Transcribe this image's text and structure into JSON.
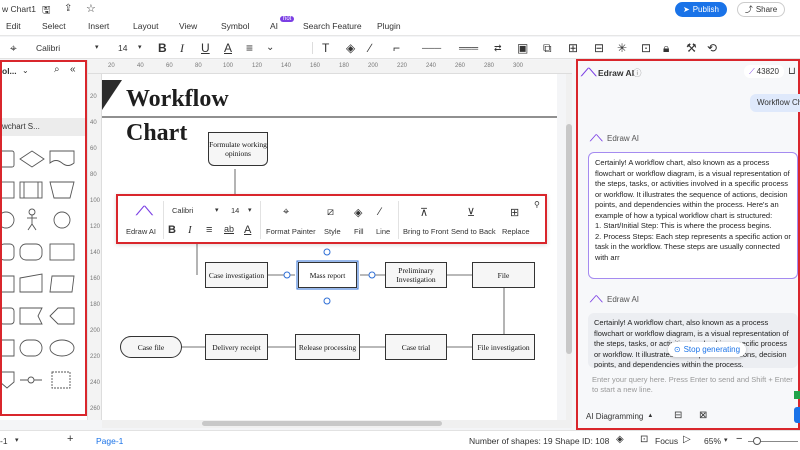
{
  "titlebar": {
    "doc_name": "w Chart1",
    "publish": "Publish",
    "share": "Share",
    "ai_badge": "hot"
  },
  "menu": {
    "edit": "Edit",
    "select": "Select",
    "insert": "Insert",
    "layout": "Layout",
    "view": "View",
    "symbol": "Symbol",
    "ai": "AI",
    "search_feature": "Search Feature",
    "plugin": "Plugin"
  },
  "toolbar": {
    "font": "Calibri",
    "size": "14"
  },
  "left_panel": {
    "title": "ol...",
    "item": "wchart S..."
  },
  "canvas": {
    "title_line1": "Workflow",
    "title_line2": "Chart",
    "nodes": {
      "formulate": "Formulate working opinions",
      "case_investigation": "Case investigation",
      "mass_report": "Mass report",
      "preliminary": "Preliminary Investigation",
      "file": "File",
      "file_investigation": "File investigation",
      "case_trial": "Case trial",
      "release": "Release processing",
      "delivery": "Delivery receipt",
      "case_file": "Case file"
    },
    "ruler_top": [
      "20",
      "40",
      "60",
      "80",
      "100",
      "120",
      "140",
      "160",
      "180",
      "200",
      "220",
      "240",
      "260",
      "280",
      "300"
    ],
    "ruler_left": [
      "20",
      "40",
      "60",
      "80",
      "100",
      "120",
      "140",
      "160",
      "180",
      "200",
      "220",
      "240",
      "260"
    ]
  },
  "floating_bar": {
    "edraw_ai": "Edraw AI",
    "font": "Calibri",
    "size": "14",
    "format_painter": "Format Painter",
    "style": "Style",
    "fill": "Fill",
    "line": "Line",
    "bring_to_front": "Bring to Front",
    "send_to_back": "Send to Back",
    "replace": "Replace"
  },
  "ai_panel": {
    "title": "Edraw AI",
    "credits": "43820",
    "user_message": "Workflow Ch",
    "assistant_label": "Edraw AI",
    "response1": "Certainly! A workflow chart, also known as a process flowchart or workflow diagram, is a visual representation of the steps, tasks, or activities involved in a specific process or workflow. It illustrates the sequence of actions, decision points, and dependencies within the process. Here's an example of how a typical workflow chart is structured:\n1. Start/Initial Step: This is where the process begins.\n2. Process Steps: Each step represents a specific action or task in the workflow. These steps are usually connected with arr",
    "response2": "Certainly! A workflow chart, also known as a process flowchart or workflow diagram, is a visual representation of the steps, tasks, or activities involved in a specific process or workflow. It illustrates the sequence of actions, decision points, and dependencies within the process.",
    "stop_generating": "Stop generating",
    "input_placeholder": "Enter your query here. Press Enter to send and Shift + Enter to start a new line.",
    "mode": "AI Diagramming"
  },
  "status": {
    "page_left": "-1",
    "page": "Page-1",
    "num_shapes": "Number of shapes: 19",
    "shape_id": "Shape ID: 108",
    "focus": "Focus",
    "zoom": "65%"
  },
  "colors": {
    "accent": "#1a73e8",
    "highlight": "#d9262c"
  }
}
